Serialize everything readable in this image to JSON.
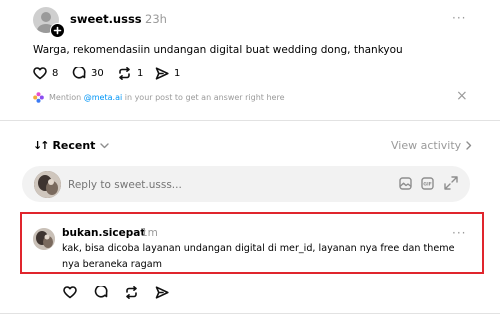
{
  "post": {
    "username": "sweet.usss",
    "time": "23h",
    "more": "···",
    "text": "Warga, rekomendasiin undangan digital buat wedding dong, thankyou",
    "stats": {
      "likes": "8",
      "replies": "30",
      "reposts": "1",
      "shares": "1"
    }
  },
  "mention_banner": {
    "prefix": "Mention ",
    "handle": "@meta.ai",
    "suffix": " in your post to get an answer right here",
    "close": "×"
  },
  "sort": {
    "label": "Recent",
    "arrows": "↓↑",
    "view_activity": "View activity"
  },
  "reply_input": {
    "placeholder": "Reply to sweet.usss..."
  },
  "reply": {
    "username": "bukan.sicepat",
    "time": "1m",
    "more": "···",
    "text_line1": "kak, bisa dicoba layanan undangan digital di mer_id, layanan nya free dan theme",
    "text_line2": "nya beraneka ragam"
  },
  "colors": {
    "accent_link": "#0095f6",
    "highlight": "#e0252d"
  }
}
